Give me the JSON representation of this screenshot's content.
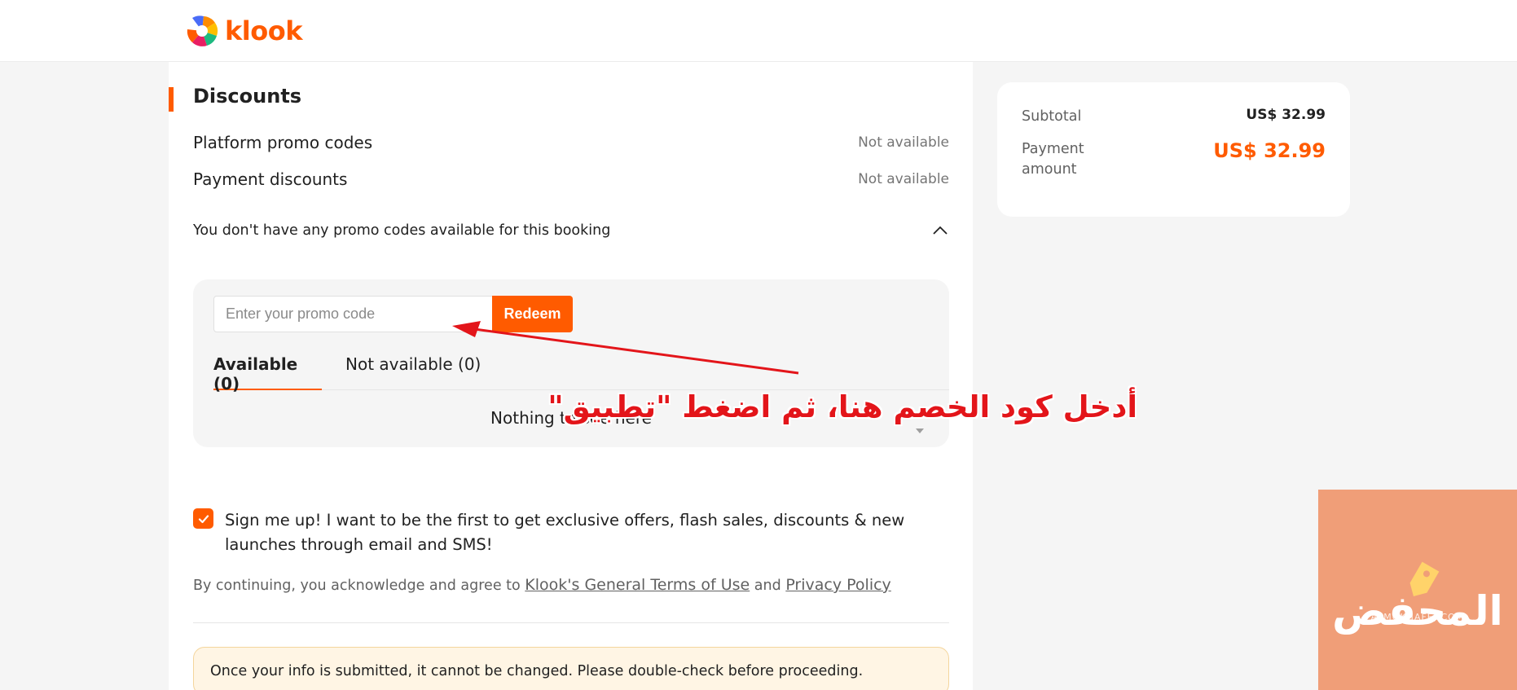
{
  "header": {
    "logo_text": "klook"
  },
  "discounts": {
    "title": "Discounts",
    "rows": [
      {
        "label": "Platform promo codes",
        "status": "Not available"
      },
      {
        "label": "Payment discounts",
        "status": "Not available"
      }
    ],
    "promo_notice": "You don't have any promo codes available for this booking",
    "promo_input": {
      "placeholder": "Enter your promo code",
      "value": ""
    },
    "redeem_label": "Redeem",
    "tabs": [
      {
        "label": "Available (0)",
        "active": true
      },
      {
        "label": "Not available (0)",
        "active": false
      }
    ],
    "empty_message": "Nothing to see here"
  },
  "signup": {
    "checked": true,
    "text": "Sign me up! I want to be the first to get exclusive offers, flash sales, discounts & new launches through email and SMS!"
  },
  "legal": {
    "prefix": "By continuing, you acknowledge and agree to",
    "terms_link": "Klook's General Terms of Use",
    "conjunction": "and",
    "privacy_link": "Privacy Policy"
  },
  "notice": {
    "text": "Once your info is submitted, it cannot be changed. Please double-check before proceeding."
  },
  "summary": {
    "subtotal_label": "Subtotal",
    "subtotal_value": "US$ 32.99",
    "payment_label_line1": "Payment",
    "payment_label_line2": "amount",
    "payment_value": "US$ 32.99"
  },
  "annotation": {
    "text": "أدخل كود الخصم هنا، ثم اضغط \"تطبيق\"",
    "color": "#e3151a"
  },
  "watermark": {
    "brand": "المحفض",
    "sub": "ALMOKHAFEJ.COM"
  },
  "colors": {
    "accent": "#ff5b00",
    "notice_bg": "#fff5e4",
    "watermark_bg": "#f09e78"
  }
}
